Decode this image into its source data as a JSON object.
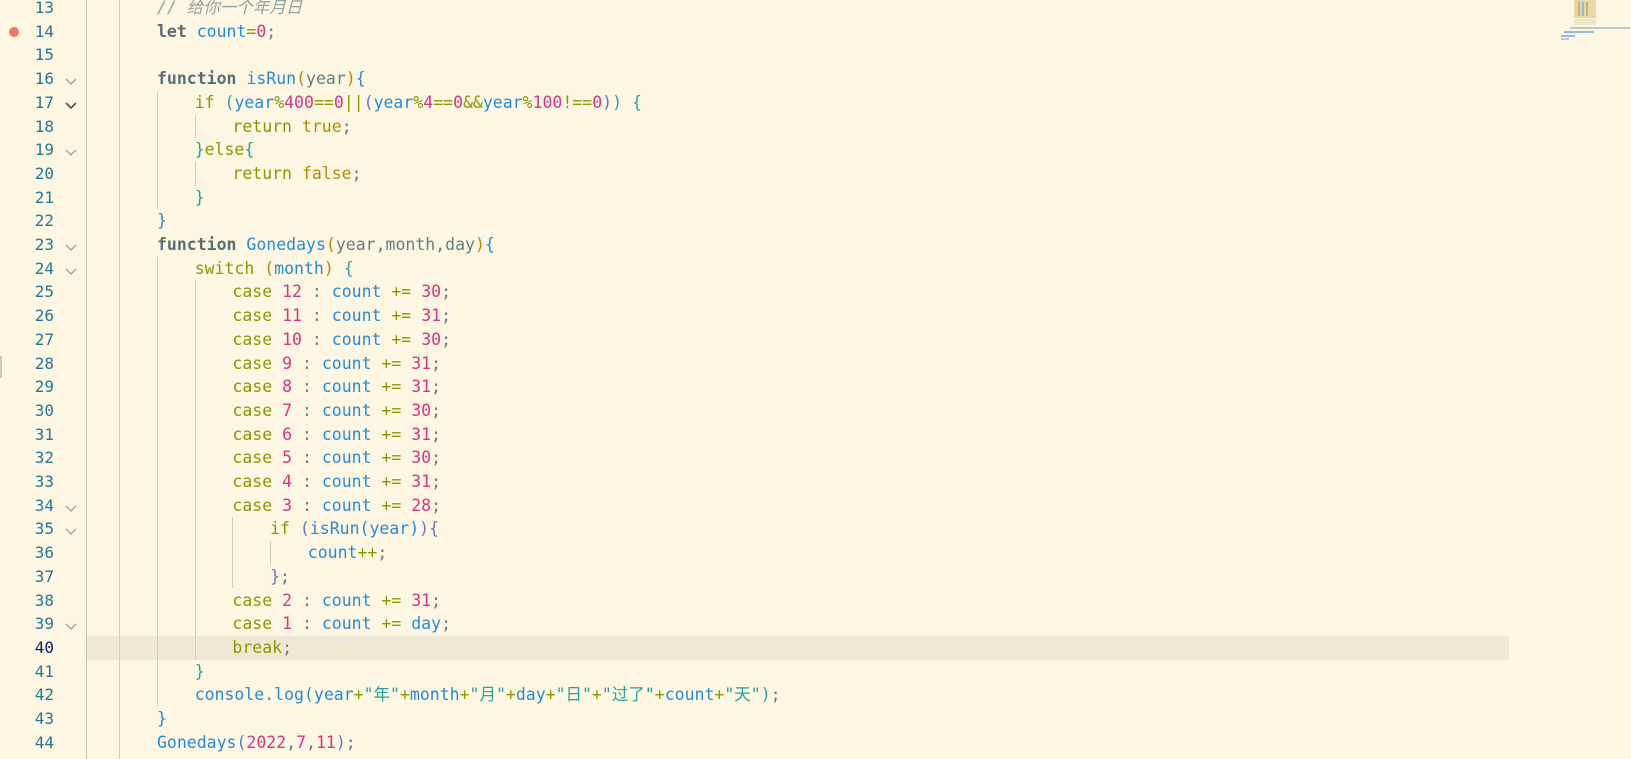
{
  "editor": {
    "current_line": 40,
    "breakpoint_line": 14,
    "lines": [
      {
        "n": "13",
        "indent": 2,
        "tokens": [
          {
            "t": "// 给你一个年月日",
            "c": "cmt"
          }
        ]
      },
      {
        "n": "14",
        "indent": 2,
        "tokens": [
          {
            "t": "let",
            "c": "kw"
          },
          {
            "t": " ",
            "c": "pun"
          },
          {
            "t": "count",
            "c": "var"
          },
          {
            "t": "=",
            "c": "op"
          },
          {
            "t": "0",
            "c": "num"
          },
          {
            "t": ";",
            "c": "pun"
          }
        ]
      },
      {
        "n": "15",
        "indent": 0,
        "tokens": []
      },
      {
        "n": "16",
        "indent": 2,
        "fold": true,
        "tokens": [
          {
            "t": "function",
            "c": "kw"
          },
          {
            "t": " ",
            "c": "pun"
          },
          {
            "t": "isRun",
            "c": "fn"
          },
          {
            "t": "(",
            "c": "b1"
          },
          {
            "t": "year",
            "c": "param"
          },
          {
            "t": ")",
            "c": "b1"
          },
          {
            "t": "{",
            "c": "b4"
          }
        ]
      },
      {
        "n": "17",
        "indent": 3,
        "fold": true,
        "fold_open": true,
        "tokens": [
          {
            "t": "if",
            "c": "ctl"
          },
          {
            "t": " ",
            "c": "pun"
          },
          {
            "t": "(",
            "c": "b2"
          },
          {
            "t": "year",
            "c": "var"
          },
          {
            "t": "%",
            "c": "op"
          },
          {
            "t": "400",
            "c": "num"
          },
          {
            "t": "==",
            "c": "op"
          },
          {
            "t": "0",
            "c": "num"
          },
          {
            "t": "||",
            "c": "op"
          },
          {
            "t": "(",
            "c": "b3"
          },
          {
            "t": "year",
            "c": "var"
          },
          {
            "t": "%",
            "c": "op"
          },
          {
            "t": "4",
            "c": "num"
          },
          {
            "t": "==",
            "c": "op"
          },
          {
            "t": "0",
            "c": "num"
          },
          {
            "t": "&&",
            "c": "op"
          },
          {
            "t": "year",
            "c": "var"
          },
          {
            "t": "%",
            "c": "op"
          },
          {
            "t": "100",
            "c": "num"
          },
          {
            "t": "!==",
            "c": "op"
          },
          {
            "t": "0",
            "c": "num"
          },
          {
            "t": ")",
            "c": "b3"
          },
          {
            "t": ")",
            "c": "b2"
          },
          {
            "t": " ",
            "c": "pun"
          },
          {
            "t": "{",
            "c": "b2"
          }
        ]
      },
      {
        "n": "18",
        "indent": 4,
        "tokens": [
          {
            "t": "return",
            "c": "ctl"
          },
          {
            "t": " ",
            "c": "pun"
          },
          {
            "t": "true",
            "c": "bool"
          },
          {
            "t": ";",
            "c": "pun"
          }
        ]
      },
      {
        "n": "19",
        "indent": 3,
        "fold": true,
        "tokens": [
          {
            "t": "}",
            "c": "b2"
          },
          {
            "t": "else",
            "c": "ctl"
          },
          {
            "t": "{",
            "c": "b2"
          }
        ]
      },
      {
        "n": "20",
        "indent": 4,
        "tokens": [
          {
            "t": "return",
            "c": "ctl"
          },
          {
            "t": " ",
            "c": "pun"
          },
          {
            "t": "false",
            "c": "bool"
          },
          {
            "t": ";",
            "c": "pun"
          }
        ]
      },
      {
        "n": "21",
        "indent": 3,
        "tokens": [
          {
            "t": "}",
            "c": "b2"
          }
        ]
      },
      {
        "n": "22",
        "indent": 2,
        "tokens": [
          {
            "t": "}",
            "c": "b4"
          }
        ]
      },
      {
        "n": "23",
        "indent": 2,
        "fold": true,
        "tokens": [
          {
            "t": "function",
            "c": "kw"
          },
          {
            "t": " ",
            "c": "pun"
          },
          {
            "t": "Gonedays",
            "c": "fn"
          },
          {
            "t": "(",
            "c": "b1"
          },
          {
            "t": "year",
            "c": "param"
          },
          {
            "t": ",",
            "c": "pun"
          },
          {
            "t": "month",
            "c": "param"
          },
          {
            "t": ",",
            "c": "pun"
          },
          {
            "t": "day",
            "c": "param"
          },
          {
            "t": ")",
            "c": "b1"
          },
          {
            "t": "{",
            "c": "b4"
          }
        ]
      },
      {
        "n": "24",
        "indent": 3,
        "fold": true,
        "tokens": [
          {
            "t": "switch",
            "c": "ctl"
          },
          {
            "t": " ",
            "c": "pun"
          },
          {
            "t": "(",
            "c": "b1"
          },
          {
            "t": "month",
            "c": "var"
          },
          {
            "t": ")",
            "c": "b1"
          },
          {
            "t": " ",
            "c": "pun"
          },
          {
            "t": "{",
            "c": "b2"
          }
        ]
      },
      {
        "n": "25",
        "indent": 4,
        "tokens": [
          {
            "t": "case",
            "c": "ctl"
          },
          {
            "t": " ",
            "c": "pun"
          },
          {
            "t": "12",
            "c": "num"
          },
          {
            "t": " : ",
            "c": "pun"
          },
          {
            "t": "count",
            "c": "var"
          },
          {
            "t": " += ",
            "c": "op"
          },
          {
            "t": "30",
            "c": "num"
          },
          {
            "t": ";",
            "c": "pun"
          }
        ]
      },
      {
        "n": "26",
        "indent": 4,
        "tokens": [
          {
            "t": "case",
            "c": "ctl"
          },
          {
            "t": " ",
            "c": "pun"
          },
          {
            "t": "11",
            "c": "num"
          },
          {
            "t": " : ",
            "c": "pun"
          },
          {
            "t": "count",
            "c": "var"
          },
          {
            "t": " += ",
            "c": "op"
          },
          {
            "t": "31",
            "c": "num"
          },
          {
            "t": ";",
            "c": "pun"
          }
        ]
      },
      {
        "n": "27",
        "indent": 4,
        "tokens": [
          {
            "t": "case",
            "c": "ctl"
          },
          {
            "t": " ",
            "c": "pun"
          },
          {
            "t": "10",
            "c": "num"
          },
          {
            "t": " : ",
            "c": "pun"
          },
          {
            "t": "count",
            "c": "var"
          },
          {
            "t": " += ",
            "c": "op"
          },
          {
            "t": "30",
            "c": "num"
          },
          {
            "t": ";",
            "c": "pun"
          }
        ]
      },
      {
        "n": "28",
        "indent": 4,
        "tokens": [
          {
            "t": "case",
            "c": "ctl"
          },
          {
            "t": " ",
            "c": "pun"
          },
          {
            "t": "9",
            "c": "num"
          },
          {
            "t": " : ",
            "c": "pun"
          },
          {
            "t": "count",
            "c": "var"
          },
          {
            "t": " += ",
            "c": "op"
          },
          {
            "t": "31",
            "c": "num"
          },
          {
            "t": ";",
            "c": "pun"
          }
        ]
      },
      {
        "n": "29",
        "indent": 4,
        "tokens": [
          {
            "t": "case",
            "c": "ctl"
          },
          {
            "t": " ",
            "c": "pun"
          },
          {
            "t": "8",
            "c": "num"
          },
          {
            "t": " : ",
            "c": "pun"
          },
          {
            "t": "count",
            "c": "var"
          },
          {
            "t": " += ",
            "c": "op"
          },
          {
            "t": "31",
            "c": "num"
          },
          {
            "t": ";",
            "c": "pun"
          }
        ]
      },
      {
        "n": "30",
        "indent": 4,
        "tokens": [
          {
            "t": "case",
            "c": "ctl"
          },
          {
            "t": " ",
            "c": "pun"
          },
          {
            "t": "7",
            "c": "num"
          },
          {
            "t": " : ",
            "c": "pun"
          },
          {
            "t": "count",
            "c": "var"
          },
          {
            "t": " += ",
            "c": "op"
          },
          {
            "t": "30",
            "c": "num"
          },
          {
            "t": ";",
            "c": "pun"
          }
        ]
      },
      {
        "n": "31",
        "indent": 4,
        "tokens": [
          {
            "t": "case",
            "c": "ctl"
          },
          {
            "t": " ",
            "c": "pun"
          },
          {
            "t": "6",
            "c": "num"
          },
          {
            "t": " : ",
            "c": "pun"
          },
          {
            "t": "count",
            "c": "var"
          },
          {
            "t": " += ",
            "c": "op"
          },
          {
            "t": "31",
            "c": "num"
          },
          {
            "t": ";",
            "c": "pun"
          }
        ]
      },
      {
        "n": "32",
        "indent": 4,
        "tokens": [
          {
            "t": "case",
            "c": "ctl"
          },
          {
            "t": " ",
            "c": "pun"
          },
          {
            "t": "5",
            "c": "num"
          },
          {
            "t": " : ",
            "c": "pun"
          },
          {
            "t": "count",
            "c": "var"
          },
          {
            "t": " += ",
            "c": "op"
          },
          {
            "t": "30",
            "c": "num"
          },
          {
            "t": ";",
            "c": "pun"
          }
        ]
      },
      {
        "n": "33",
        "indent": 4,
        "tokens": [
          {
            "t": "case",
            "c": "ctl"
          },
          {
            "t": " ",
            "c": "pun"
          },
          {
            "t": "4",
            "c": "num"
          },
          {
            "t": " : ",
            "c": "pun"
          },
          {
            "t": "count",
            "c": "var"
          },
          {
            "t": " += ",
            "c": "op"
          },
          {
            "t": "31",
            "c": "num"
          },
          {
            "t": ";",
            "c": "pun"
          }
        ]
      },
      {
        "n": "34",
        "indent": 4,
        "fold": true,
        "tokens": [
          {
            "t": "case",
            "c": "ctl"
          },
          {
            "t": " ",
            "c": "pun"
          },
          {
            "t": "3",
            "c": "num"
          },
          {
            "t": " : ",
            "c": "pun"
          },
          {
            "t": "count",
            "c": "var"
          },
          {
            "t": " += ",
            "c": "op"
          },
          {
            "t": "28",
            "c": "num"
          },
          {
            "t": ";",
            "c": "pun"
          }
        ]
      },
      {
        "n": "35",
        "indent": 5,
        "fold": true,
        "tokens": [
          {
            "t": "if",
            "c": "ctl"
          },
          {
            "t": " ",
            "c": "pun"
          },
          {
            "t": "(",
            "c": "b3"
          },
          {
            "t": "isRun",
            "c": "fn"
          },
          {
            "t": "(",
            "c": "b4"
          },
          {
            "t": "year",
            "c": "var"
          },
          {
            "t": ")",
            "c": "b4"
          },
          {
            "t": ")",
            "c": "b3"
          },
          {
            "t": "{",
            "c": "b3"
          }
        ]
      },
      {
        "n": "36",
        "indent": 6,
        "tokens": [
          {
            "t": "count",
            "c": "var"
          },
          {
            "t": "++",
            "c": "op"
          },
          {
            "t": ";",
            "c": "pun"
          }
        ]
      },
      {
        "n": "37",
        "indent": 5,
        "tokens": [
          {
            "t": "}",
            "c": "b3"
          },
          {
            "t": ";",
            "c": "pun"
          }
        ]
      },
      {
        "n": "38",
        "indent": 4,
        "tokens": [
          {
            "t": "case",
            "c": "ctl"
          },
          {
            "t": " ",
            "c": "pun"
          },
          {
            "t": "2",
            "c": "num"
          },
          {
            "t": " : ",
            "c": "pun"
          },
          {
            "t": "count",
            "c": "var"
          },
          {
            "t": " += ",
            "c": "op"
          },
          {
            "t": "31",
            "c": "num"
          },
          {
            "t": ";",
            "c": "pun"
          }
        ]
      },
      {
        "n": "39",
        "indent": 4,
        "fold": true,
        "tokens": [
          {
            "t": "case",
            "c": "ctl"
          },
          {
            "t": " ",
            "c": "pun"
          },
          {
            "t": "1",
            "c": "num"
          },
          {
            "t": " : ",
            "c": "pun"
          },
          {
            "t": "count",
            "c": "var"
          },
          {
            "t": " += ",
            "c": "op"
          },
          {
            "t": "day",
            "c": "var"
          },
          {
            "t": ";",
            "c": "pun"
          }
        ]
      },
      {
        "n": "40",
        "indent": 4,
        "tokens": [
          {
            "t": "break",
            "c": "ctl"
          },
          {
            "t": ";",
            "c": "pun"
          }
        ]
      },
      {
        "n": "41",
        "indent": 3,
        "tokens": [
          {
            "t": "}",
            "c": "b2"
          }
        ]
      },
      {
        "n": "42",
        "indent": 3,
        "tokens": [
          {
            "t": "console",
            "c": "var"
          },
          {
            "t": ".",
            "c": "pun"
          },
          {
            "t": "log",
            "c": "fn"
          },
          {
            "t": "(",
            "c": "b2"
          },
          {
            "t": "year",
            "c": "var"
          },
          {
            "t": "+",
            "c": "op"
          },
          {
            "t": "\"年\"",
            "c": "str"
          },
          {
            "t": "+",
            "c": "op"
          },
          {
            "t": "month",
            "c": "var"
          },
          {
            "t": "+",
            "c": "op"
          },
          {
            "t": "\"月\"",
            "c": "str"
          },
          {
            "t": "+",
            "c": "op"
          },
          {
            "t": "day",
            "c": "var"
          },
          {
            "t": "+",
            "c": "op"
          },
          {
            "t": "\"日\"",
            "c": "str"
          },
          {
            "t": "+",
            "c": "op"
          },
          {
            "t": "\"过了\"",
            "c": "str"
          },
          {
            "t": "+",
            "c": "op"
          },
          {
            "t": "count",
            "c": "var"
          },
          {
            "t": "+",
            "c": "op"
          },
          {
            "t": "\"天\"",
            "c": "str"
          },
          {
            "t": ")",
            "c": "b2"
          },
          {
            "t": ";",
            "c": "pun"
          }
        ]
      },
      {
        "n": "43",
        "indent": 2,
        "tokens": [
          {
            "t": "}",
            "c": "b4"
          }
        ]
      },
      {
        "n": "44",
        "indent": 2,
        "tokens": [
          {
            "t": "Gonedays",
            "c": "fn"
          },
          {
            "t": "(",
            "c": "b3"
          },
          {
            "t": "2022",
            "c": "num"
          },
          {
            "t": ",",
            "c": "pun"
          },
          {
            "t": "7",
            "c": "num"
          },
          {
            "t": ",",
            "c": "pun"
          },
          {
            "t": "11",
            "c": "num"
          },
          {
            "t": ")",
            "c": "b3"
          },
          {
            "t": ";",
            "c": "pun"
          }
        ]
      }
    ]
  },
  "colors": {
    "background": "#fdf6e3",
    "line_highlight": "#eee8d5",
    "line_number": "#237893",
    "breakpoint": "#e51400"
  }
}
